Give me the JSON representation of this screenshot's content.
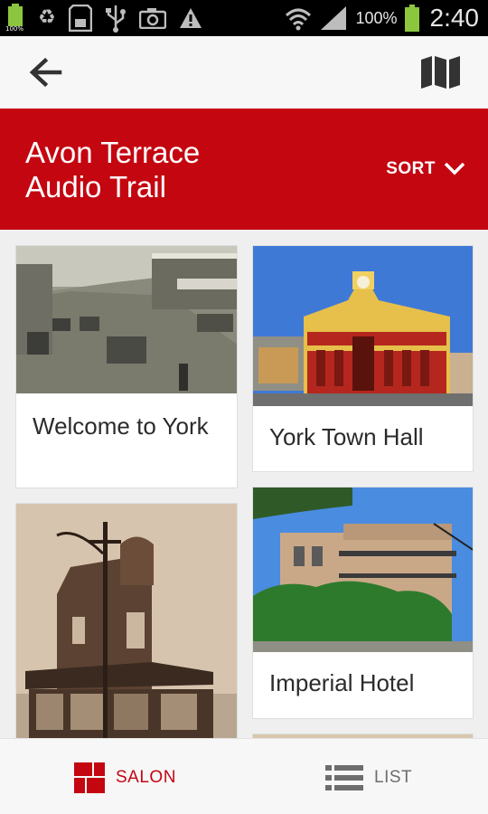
{
  "status_bar": {
    "small_battery_percent": "100%",
    "battery_percent": "100%",
    "time": "2:40"
  },
  "action_bar": {
    "back_icon": "arrow-left-icon",
    "map_icon": "folded-map-icon"
  },
  "header": {
    "title_line1": "Avon Terrace",
    "title_line2": "Audio Trail",
    "sort_label": "SORT",
    "background_color": "#c40611"
  },
  "cards": [
    {
      "caption": "Welcome to York",
      "image": "sepia street scene with horse cart"
    },
    {
      "caption": "York Town Hall",
      "image": "ornate yellow and red town hall"
    },
    {
      "caption": "",
      "image": "sepia photo of corner brick building"
    },
    {
      "caption": "Imperial Hotel",
      "image": "two storey hotel with verandah"
    }
  ],
  "tab_bar": {
    "salon_label": "SALON",
    "list_label": "LIST",
    "active_tab": "SALON",
    "accent_color": "#c40611"
  }
}
